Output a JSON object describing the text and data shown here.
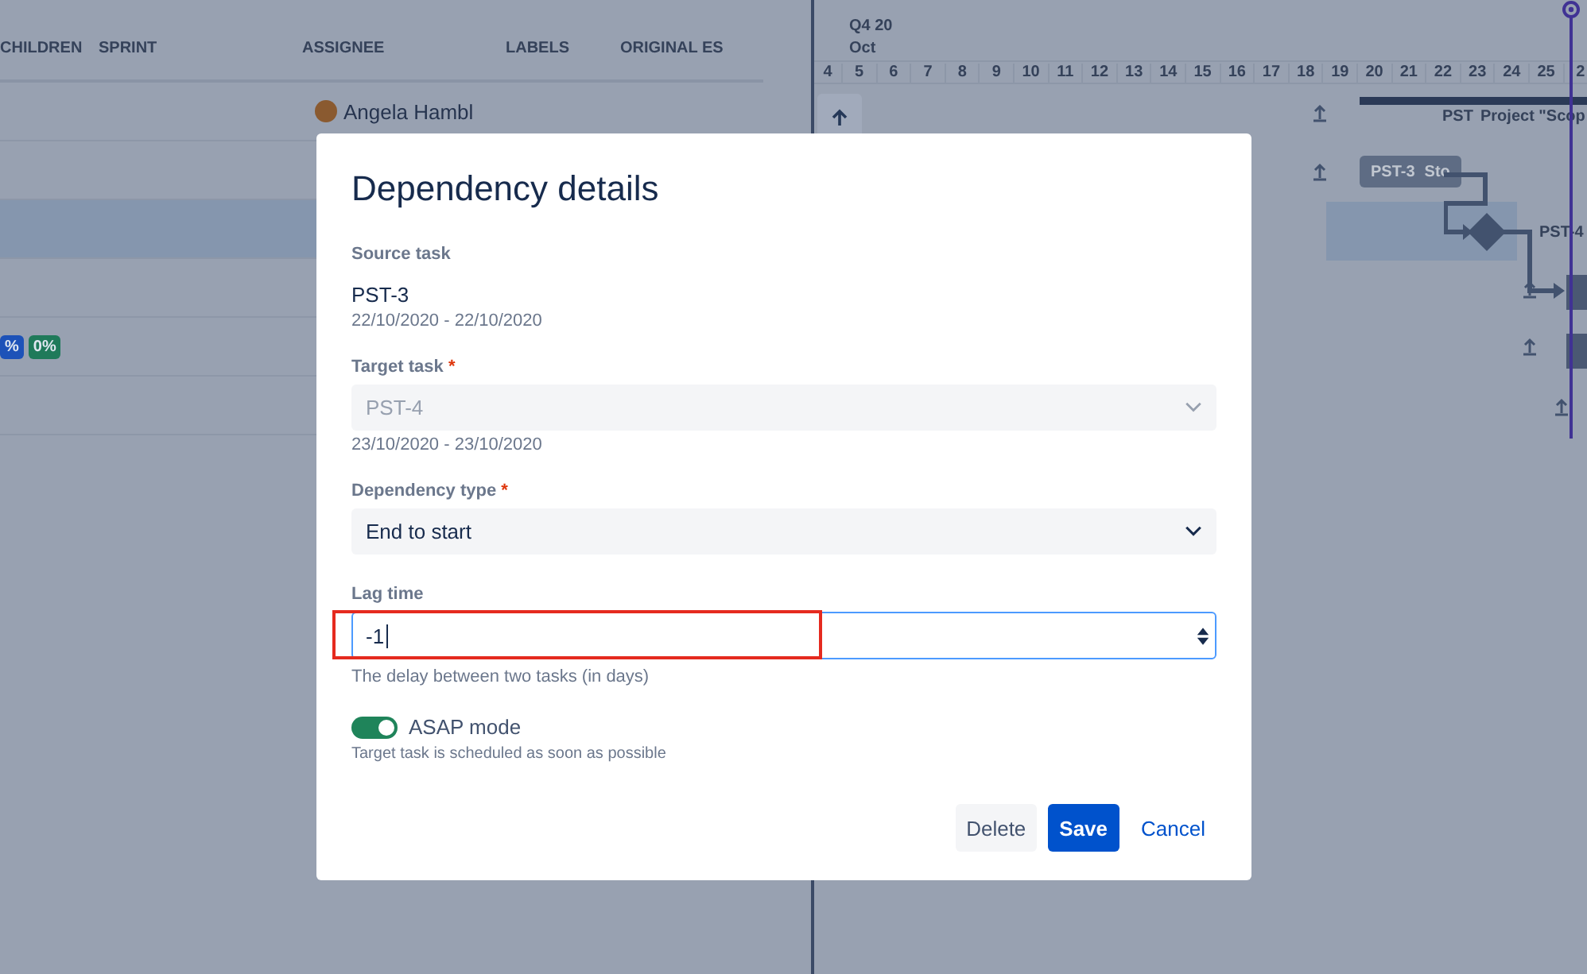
{
  "table": {
    "columns": [
      {
        "label": "CHILDREN"
      },
      {
        "label": "SPRINT"
      },
      {
        "label": "ASSIGNEE"
      },
      {
        "label": "LABELS"
      },
      {
        "label": "ORIGINAL ES"
      }
    ],
    "rows": [
      {
        "selected": false,
        "assignee": "Angela Hambl",
        "badges": []
      },
      {
        "selected": false,
        "badges": []
      },
      {
        "selected": true,
        "badges": []
      },
      {
        "selected": false,
        "badges": []
      },
      {
        "selected": false,
        "badges": [
          {
            "text": "%",
            "color": "#1d52b8"
          },
          {
            "text": "0%",
            "color": "#1f7a5a"
          }
        ]
      },
      {
        "selected": false,
        "badges": []
      }
    ]
  },
  "timeline": {
    "quarter": "Q4 20",
    "month": "Oct",
    "days": [
      "4",
      "5",
      "6",
      "7",
      "8",
      "9",
      "10",
      "11",
      "12",
      "13",
      "14",
      "15",
      "16",
      "17",
      "18",
      "19",
      "20",
      "21",
      "22",
      "23",
      "24",
      "25",
      "2"
    ],
    "items": [
      {
        "kind": "summary",
        "key": "PST",
        "title": "Project \"Scop"
      },
      {
        "kind": "task",
        "key": "PST-3",
        "title": "Sto"
      },
      {
        "kind": "milestone",
        "key": "PST-4"
      }
    ]
  },
  "dialog": {
    "title": "Dependency details",
    "source_task": {
      "label": "Source task",
      "key": "PST-3",
      "dates": "22/10/2020 - 22/10/2020"
    },
    "target_task": {
      "label": "Target task",
      "required_mark": "*",
      "value": "PST-4",
      "disabled": true,
      "dates": "23/10/2020 - 23/10/2020"
    },
    "dependency_type": {
      "label": "Dependency type",
      "required_mark": "*",
      "value": "End to start"
    },
    "lag_time": {
      "label": "Lag time",
      "value": "-1",
      "focused": true,
      "help": "The delay between two tasks (in days)"
    },
    "asap": {
      "label": "ASAP mode",
      "on": true,
      "help": "Target task is scheduled as soon as possible"
    },
    "buttons": [
      {
        "label": "Delete",
        "kind": "subtle"
      },
      {
        "label": "Save",
        "kind": "primary"
      },
      {
        "label": "Cancel",
        "kind": "link"
      }
    ]
  }
}
